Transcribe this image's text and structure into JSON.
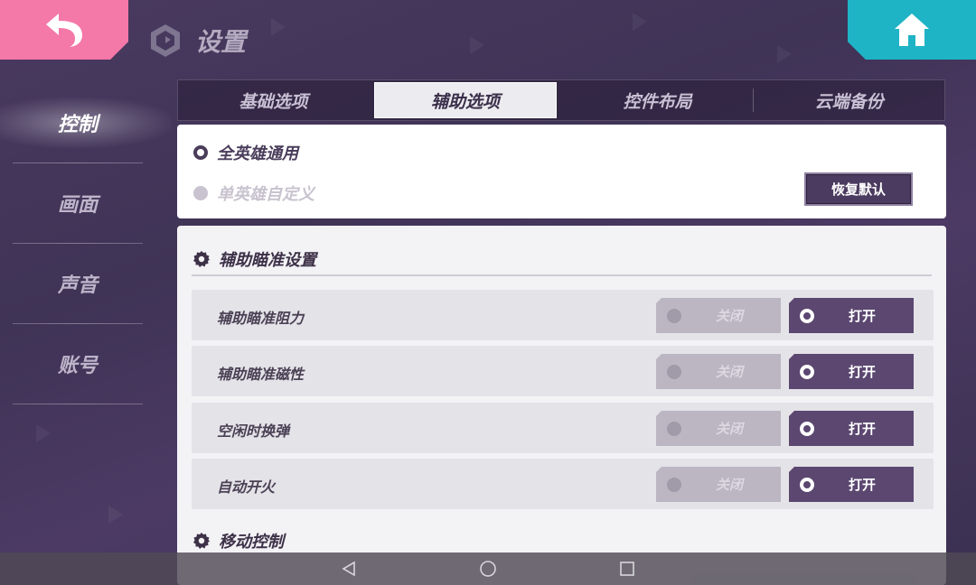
{
  "header": {
    "title": "设置"
  },
  "sidebar": {
    "items": [
      {
        "label": "控制",
        "active": true
      },
      {
        "label": "画面",
        "active": false
      },
      {
        "label": "声音",
        "active": false
      },
      {
        "label": "账号",
        "active": false
      }
    ]
  },
  "tabs": [
    {
      "label": "基础选项",
      "active": false
    },
    {
      "label": "辅助选项",
      "active": true
    },
    {
      "label": "控件布局",
      "active": false
    },
    {
      "label": "云端备份",
      "active": false
    }
  ],
  "mode": {
    "option_all": "全英雄通用",
    "option_single": "单英雄自定义",
    "selected": "全英雄通用",
    "restore_label": "恢复默认"
  },
  "sections": {
    "aim": {
      "title": "辅助瞄准设置",
      "rows": [
        {
          "label": "辅助瞄准阻力",
          "off": "关闭",
          "on": "打开",
          "value": "打开"
        },
        {
          "label": "辅助瞄准磁性",
          "off": "关闭",
          "on": "打开",
          "value": "打开"
        },
        {
          "label": "空闲时换弹",
          "off": "关闭",
          "on": "打开",
          "value": "打开"
        },
        {
          "label": "自动开火",
          "off": "关闭",
          "on": "打开",
          "value": "打开"
        }
      ]
    },
    "move": {
      "title": "移动控制"
    }
  },
  "colors": {
    "back": "#f478a8",
    "home": "#1fb3c6",
    "accent": "#5b4770"
  }
}
